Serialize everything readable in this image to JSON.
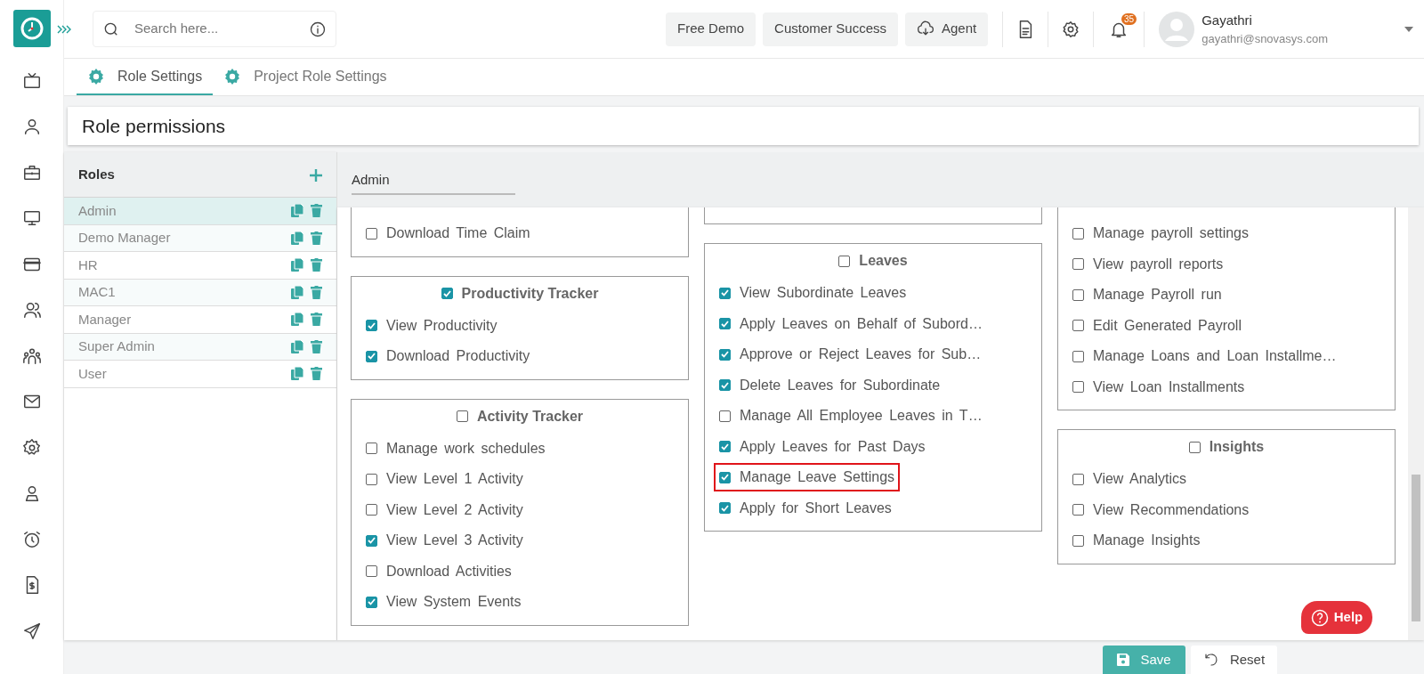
{
  "top_bar": {
    "search": {
      "placeholder": "Search here..."
    },
    "buttons": [
      {
        "label": "Free Demo",
        "kind": "plain"
      },
      {
        "label": "Customer Success",
        "kind": "plain"
      },
      {
        "label": "Agent",
        "kind": "cloud"
      }
    ],
    "notification_count": "35",
    "user": {
      "name": "Gayathri",
      "email": "gayathri@snovasys.com"
    }
  },
  "tabs": [
    {
      "label": "Role Settings",
      "selected": true
    },
    {
      "label": "Project Role Settings",
      "selected": false
    }
  ],
  "page_title": "Role permissions",
  "roles": {
    "title": "Roles",
    "items": [
      {
        "name": "Admin",
        "selected": true
      },
      {
        "name": "Demo Manager",
        "selected": false
      },
      {
        "name": "HR",
        "selected": false
      },
      {
        "name": "MAC1",
        "selected": false
      },
      {
        "name": "Manager",
        "selected": false
      },
      {
        "name": "Super Admin",
        "selected": false
      },
      {
        "name": "User",
        "selected": false
      }
    ]
  },
  "role_name": {
    "value": "Admin"
  },
  "permission_columns": [
    [
      {
        "items": [
          {
            "label": "Download Time Claim",
            "checked": false,
            "highlighted": false
          }
        ]
      },
      {
        "title": "Productivity Tracker",
        "checked": true,
        "items": [
          {
            "label": "View Productivity",
            "checked": true,
            "highlighted": false
          },
          {
            "label": "Download Productivity",
            "checked": true,
            "highlighted": false
          }
        ]
      },
      {
        "title": "Activity Tracker",
        "checked": false,
        "items": [
          {
            "label": "Manage work schedules",
            "checked": false,
            "highlighted": false
          },
          {
            "label": "View Level 1 Activity",
            "checked": false,
            "highlighted": false
          },
          {
            "label": "View Level 2 Activity",
            "checked": false,
            "highlighted": false
          },
          {
            "label": "View Level 3 Activity",
            "checked": true,
            "highlighted": false
          },
          {
            "label": "Download Activities",
            "checked": false,
            "highlighted": false
          },
          {
            "label": "View System Events",
            "checked": true,
            "highlighted": false
          }
        ]
      }
    ],
    [
      {},
      {
        "title": "Leaves",
        "checked": false,
        "items": [
          {
            "label": "View Subordinate Leaves",
            "checked": true,
            "highlighted": false
          },
          {
            "label": "Apply Leaves on Behalf of Subord…",
            "checked": true,
            "highlighted": false
          },
          {
            "label": "Approve or Reject Leaves for Sub…",
            "checked": true,
            "highlighted": false
          },
          {
            "label": "Delete Leaves for Subordinate",
            "checked": true,
            "highlighted": false
          },
          {
            "label": "Manage All Employee Leaves in T…",
            "checked": false,
            "highlighted": false
          },
          {
            "label": "Apply Leaves for Past Days",
            "checked": true,
            "highlighted": false
          },
          {
            "label": "Manage Leave Settings",
            "checked": true,
            "highlighted": true
          },
          {
            "label": "Apply for Short Leaves",
            "checked": true,
            "highlighted": false
          }
        ]
      }
    ],
    [
      {
        "items": [
          {
            "label": "Manage payroll settings",
            "checked": false,
            "highlighted": false
          },
          {
            "label": "View payroll reports",
            "checked": false,
            "highlighted": false
          },
          {
            "label": "Manage Payroll run",
            "checked": false,
            "highlighted": false
          },
          {
            "label": "Edit Generated Payroll",
            "checked": false,
            "highlighted": false
          },
          {
            "label": "Manage Loans and Loan Installme…",
            "checked": false,
            "highlighted": false
          },
          {
            "label": "View Loan Installments",
            "checked": false,
            "highlighted": false
          }
        ]
      },
      {
        "title": "Insights",
        "checked": false,
        "items": [
          {
            "label": "View Analytics",
            "checked": false,
            "highlighted": false
          },
          {
            "label": "View Recommendations",
            "checked": false,
            "highlighted": false
          },
          {
            "label": "Manage Insights",
            "checked": false,
            "highlighted": false
          }
        ]
      }
    ]
  ],
  "help": {
    "label": "Help"
  },
  "actions": {
    "save": "Save",
    "reset": "Reset"
  }
}
